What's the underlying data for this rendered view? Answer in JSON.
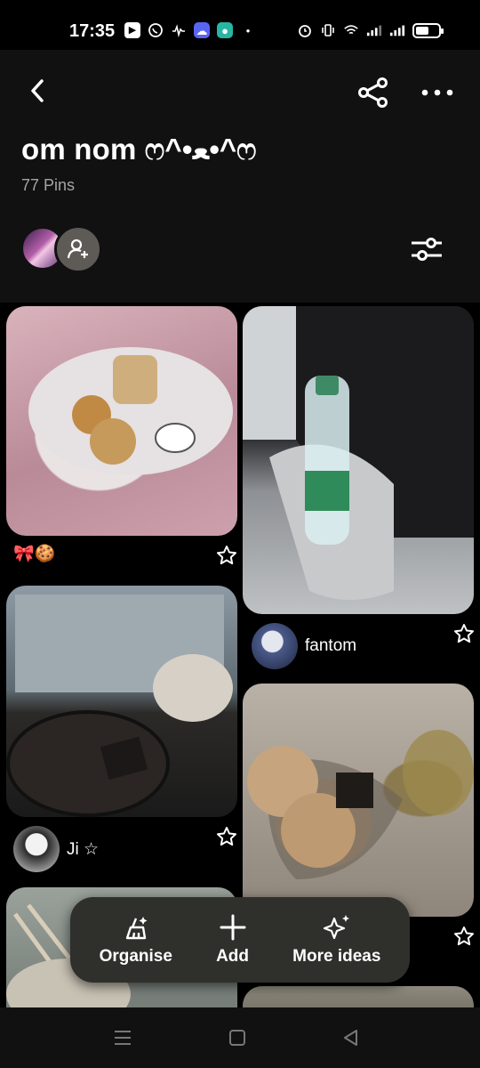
{
  "status_bar": {
    "time": "17:35",
    "battery_level": 0.6,
    "left_icons": [
      "youtube-icon",
      "whatsapp-icon",
      "tiktok-icon",
      "cloud-app-icon",
      "chat-app-icon",
      "dot-icon"
    ],
    "right_icons": [
      "alarm-icon",
      "vibrate-icon",
      "wifi-icon",
      "signal-icon",
      "signal-icon",
      "battery-icon"
    ]
  },
  "header": {
    "title": "om nom ෆ^•ﻌ•^ෆ",
    "pin_count": "77 Pins",
    "icons": {
      "back": "back-chevron-icon",
      "share": "share-icon",
      "more": "more-dots-icon",
      "filter": "filter-sliders-icon",
      "add_collaborator": "add-person-icon"
    }
  },
  "pins": [
    {
      "id": "cookies",
      "caption_emoji": "🎀🍪",
      "author": ""
    },
    {
      "id": "water",
      "author": "fantom"
    },
    {
      "id": "anime",
      "author": "Ji ☆"
    },
    {
      "id": "biscuits",
      "author": ""
    }
  ],
  "action_bar": {
    "organise": "Organise",
    "add": "Add",
    "more_ideas": "More ideas"
  },
  "colors": {
    "background": "#000000",
    "header_bg": "#111111",
    "action_bar_bg": "#2f2f2c",
    "muted_text": "#a4a4a4"
  }
}
